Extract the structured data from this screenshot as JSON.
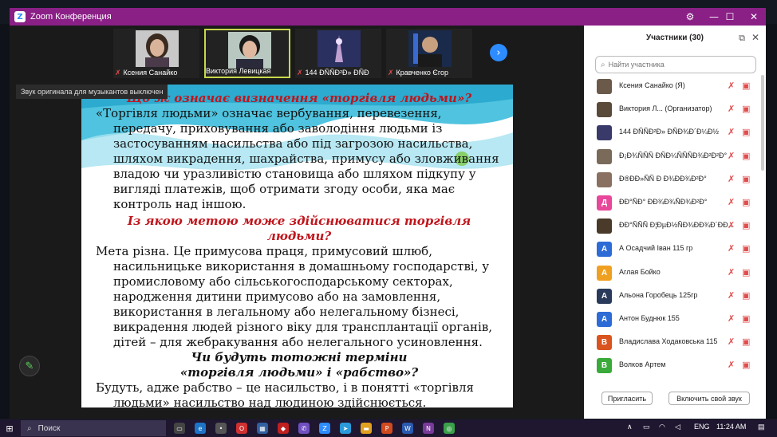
{
  "window": {
    "title": "Zoom Конференция",
    "controls": {
      "settings": "⚙",
      "minimize": "—",
      "maximize": "☐",
      "close": "✕"
    }
  },
  "thumbnails": [
    {
      "name": "Ксения Санайко"
    },
    {
      "name": "Виктория Левицкая"
    },
    {
      "name": "144 ÐÑÑÐ²Ð» ÐÑÐ"
    },
    {
      "name": "Кравченко Єгор"
    }
  ],
  "notice": "Звук оригинала для музыкантов выключен",
  "slide": {
    "heading1": "Що ж означає визначення «торгівля людьми»?",
    "para1": "«Торгівля людьми» означає вербування, перевезення, передачу, приховування або заволодіння людьми із застосуванням насильства або під загрозою насильства, шляхом викрадення, шахрайства, примусу або зловживання владою чи уразливістю становища або шляхом підкупу у вигляді платежів, щоб отримати згоду особи, яка має контроль над іншою.",
    "heading2": "Із якою метою може здійснюватися торгівля людьми?",
    "para2": "Мета різна. Це примусова праця, примусовий шлюб, насильницьке використання в домашньому господарстві, у промисловому або сільськогосподарському секторах, народження дитини примусово або на замовлення, використання в легальному або нелегальному бізнесі, викрадення людей різного віку для трансплантації органів, дітей – для жебракування або нелегального усиновлення.",
    "heading3": "Чи будуть тотожні терміни «торгівля людьми» і «рабство»?",
    "para3": "Будуть, адже рабство – це насильство, і в понятті «торгівля людьми» насильство над людиною здійснюється."
  },
  "panel": {
    "title": "Участники (30)",
    "search_placeholder": "Найти участника",
    "participants": [
      {
        "name": "Ксения Санайко (Я)",
        "avatar": "",
        "color": "#6b5a4a"
      },
      {
        "name": "Виктория Л... (Организатор)",
        "avatar": "",
        "color": "#5a4a3a"
      },
      {
        "name": "144 ÐÑÑÐ²Ð» ÐÑÐ¾Ð´Ð¼Ð½",
        "avatar": "",
        "color": "#3a3a6a"
      },
      {
        "name": "Ð¡Ð¾ÑÑÑ ÐÑÐ¼ÑÑÑÐ¾Ð²Ð²Ð°",
        "avatar": "",
        "color": "#7a6a5a"
      },
      {
        "name": "Ð®ÐÐ»ÑÑ Ð Ð¾ÐÐ¾Ð²Ð°",
        "avatar": "",
        "color": "#8a7060"
      },
      {
        "name": "ÐÐ°ÑÐ° ÐÐ¾Ð¾ÑÐ¾Ð²Ð°",
        "avatar": "Д",
        "color": "#e8479a"
      },
      {
        "name": "ÐÐ°ÑÑÑ Ð¦ÐµÐ½ÑÐ¾ÐÐ¾Ð´ÐÐ...",
        "avatar": "",
        "color": "#4a3a2a"
      },
      {
        "name": "А Осадчий Іван 115 гр",
        "avatar": "А",
        "color": "#2d6cd6"
      },
      {
        "name": "Аглая Бойко",
        "avatar": "А",
        "color": "#f0a020"
      },
      {
        "name": "Альона Горобець 125гр",
        "avatar": "А",
        "color": "#2a3a5a"
      },
      {
        "name": "Антон Буднюк 155",
        "avatar": "А",
        "color": "#2d6cd6"
      },
      {
        "name": "Владислава Ходаковська 115",
        "avatar": "В",
        "color": "#d9541e"
      },
      {
        "name": "Волков Артем",
        "avatar": "В",
        "color": "#3aaa3a"
      }
    ],
    "invite": "Пригласить",
    "unmute": "Включить свой звук"
  },
  "taskbar": {
    "search": "Поиск",
    "lang": "ENG",
    "time": "11:24 AM"
  }
}
